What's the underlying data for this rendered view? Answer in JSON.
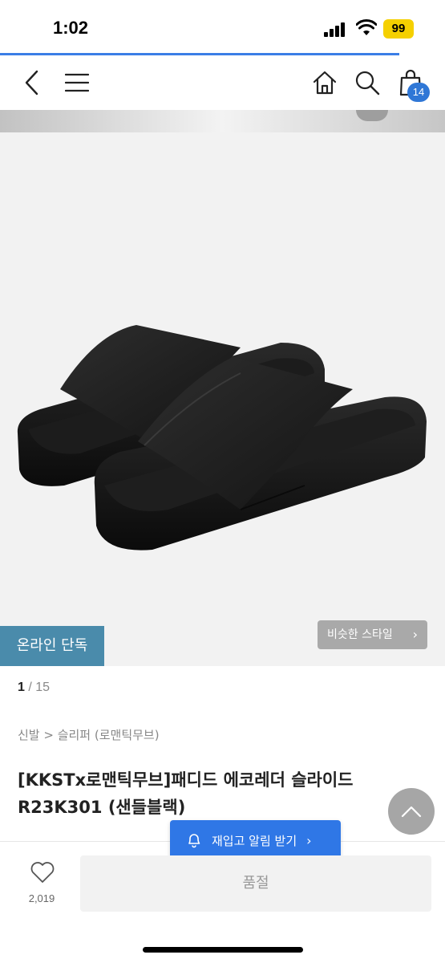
{
  "status_bar": {
    "time": "1:02",
    "battery": "99"
  },
  "header": {
    "back_icon": "chevron-left-icon",
    "menu_icon": "hamburger-menu-icon",
    "home_icon": "home-icon",
    "search_icon": "search-icon",
    "cart_icon": "shopping-bag-icon",
    "cart_count": "14"
  },
  "gallery": {
    "badge": "온라인 단독",
    "similar_style": "비슷한 스타일",
    "current": "1",
    "separator": "/",
    "total": "15"
  },
  "product": {
    "breadcrumb": "신발 > 슬리퍼 (로맨틱무브)",
    "title": "[KKSTx로맨틱무브]패디드 에코레더 슬라이드 R23K301 (샌들블랙)"
  },
  "actions": {
    "restock_alert": "재입고 알림 받기",
    "like_count": "2,019",
    "sold_out": "품절"
  },
  "colors": {
    "accent": "#2f77e6",
    "badge": "#4a8bab"
  }
}
